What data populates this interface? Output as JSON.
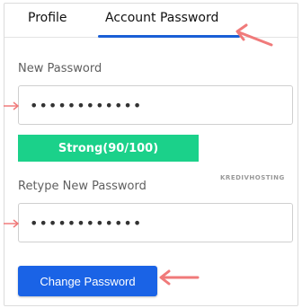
{
  "tabs": {
    "profile": "Profile",
    "account_password": "Account Password"
  },
  "form": {
    "new_password_label": "New Password",
    "new_password_value": "••••••••••••",
    "strength_text": "Strong(90/100)",
    "retype_label": "Retype New Password",
    "retype_value": "••••••••••••",
    "submit_label": "Change Password"
  },
  "watermark": "KREDIVHOSTING",
  "colors": {
    "accent": "#1a63e6",
    "strength": "#1bd18a",
    "arrow": "#f07a7a"
  },
  "icons": [
    "arrow-left-icon",
    "arrow-right-icon",
    "arrow-up-left-icon"
  ]
}
